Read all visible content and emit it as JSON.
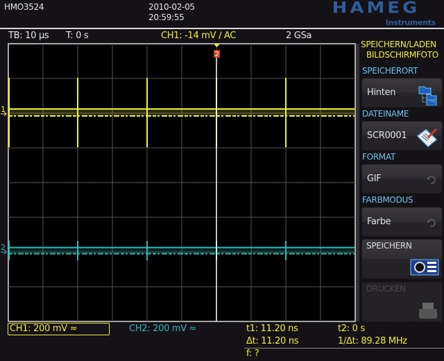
{
  "header": {
    "model": "HMO3524",
    "date": "2010-02-05",
    "time": "20:59:55",
    "brand": "HAMEG",
    "brand_sub": "Instruments"
  },
  "status": {
    "timebase": "TB: 10 µs",
    "trigger_time": "T: 0 s",
    "ch1_trigger": "CH1: -14 mV ∕ AC",
    "sample_rate": "2 GSa"
  },
  "markers": {
    "ch1": "1",
    "ch2": "2",
    "cursor": "2"
  },
  "menu": {
    "title1": "SPEICHERN/LADEN",
    "title2": "BILDSCHIRMFOTO",
    "items": [
      {
        "section": "SPEICHERORT",
        "value": "Hinten",
        "icon": "folder-tree-icon"
      },
      {
        "section": "DATEINAME",
        "value": "SCR0001",
        "icon": "notepad-pen-icon"
      },
      {
        "section": "FORMAT",
        "value": "GIF",
        "icon": "rotate-icon"
      },
      {
        "section": "FARBMODUS",
        "value": "Farbe",
        "icon": "rotate-icon"
      }
    ],
    "save": "SPEICHERN",
    "print": "DRUCKEN"
  },
  "footer": {
    "ch1": "CH1: 200 mV ≈",
    "ch2": "CH2: 200 mV ≈",
    "t1": "t1: 11.20 ns",
    "t2": "t2: 0 s",
    "dt": "Δt: 11.20 ns",
    "inv_dt": "1/Δt: 89.28 MHz",
    "f": "f: ?"
  },
  "colors": {
    "ch1": "#f0f040",
    "ch2": "#2fb8b8",
    "accent": "#6ec3e8"
  }
}
